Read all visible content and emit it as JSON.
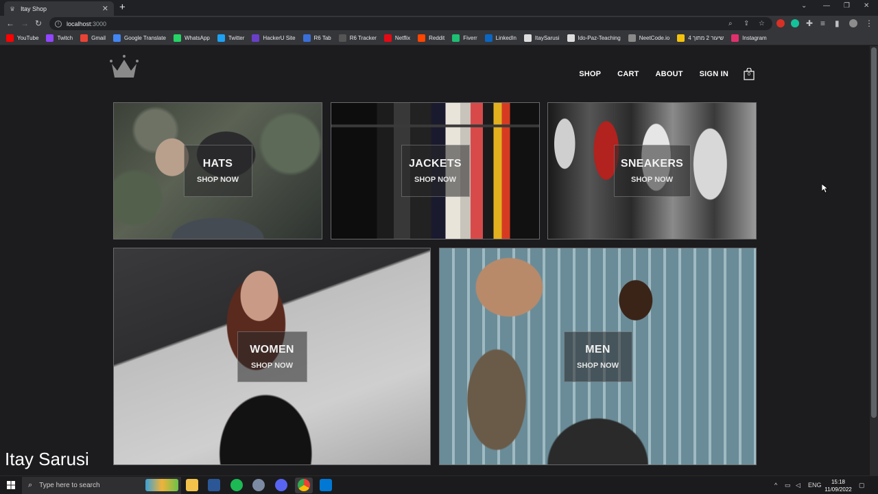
{
  "browser": {
    "tab_title": "Itay Shop",
    "url_host": "localhost",
    "url_port": ":3000",
    "bookmarks": [
      {
        "label": "YouTube",
        "color": "#ff0000"
      },
      {
        "label": "Twitch",
        "color": "#9146ff"
      },
      {
        "label": "Gmail",
        "color": "#ea4335"
      },
      {
        "label": "Google Translate",
        "color": "#4285f4"
      },
      {
        "label": "WhatsApp",
        "color": "#25d366"
      },
      {
        "label": "Twitter",
        "color": "#1da1f2"
      },
      {
        "label": "HackerU Site",
        "color": "#6a3fc8"
      },
      {
        "label": "R6 Tab",
        "color": "#3a6fd8"
      },
      {
        "label": "R6 Tracker",
        "color": "#555555"
      },
      {
        "label": "Netflix",
        "color": "#e50914"
      },
      {
        "label": "Reddit",
        "color": "#ff4500"
      },
      {
        "label": "Fiverr",
        "color": "#1dbf73"
      },
      {
        "label": "LinkedIn",
        "color": "#0a66c2"
      },
      {
        "label": "ItaySarusi",
        "color": "#dddddd"
      },
      {
        "label": "Ido-Paz-Teaching",
        "color": "#dddddd"
      },
      {
        "label": "NeetCode.io",
        "color": "#8a8a8a"
      },
      {
        "label": "שיעור 2 מתוך 4",
        "color": "#f4c20d"
      },
      {
        "label": "Instagram",
        "color": "#e1306c"
      }
    ]
  },
  "site": {
    "nav": [
      "SHOP",
      "CART",
      "ABOUT",
      "SIGN IN"
    ],
    "cart_count": "0",
    "categories": [
      {
        "title": "HATS",
        "cta": "SHOP NOW"
      },
      {
        "title": "JACKETS",
        "cta": "SHOP NOW"
      },
      {
        "title": "SNEAKERS",
        "cta": "SHOP NOW"
      },
      {
        "title": "WOMEN",
        "cta": "SHOP NOW"
      },
      {
        "title": "MEN",
        "cta": "SHOP NOW"
      }
    ]
  },
  "overlay": {
    "watermark": "Itay Sarusi"
  },
  "taskbar": {
    "search_placeholder": "Type here to search",
    "language": "ENG",
    "time": "15:18",
    "date": "11/09/2022"
  }
}
